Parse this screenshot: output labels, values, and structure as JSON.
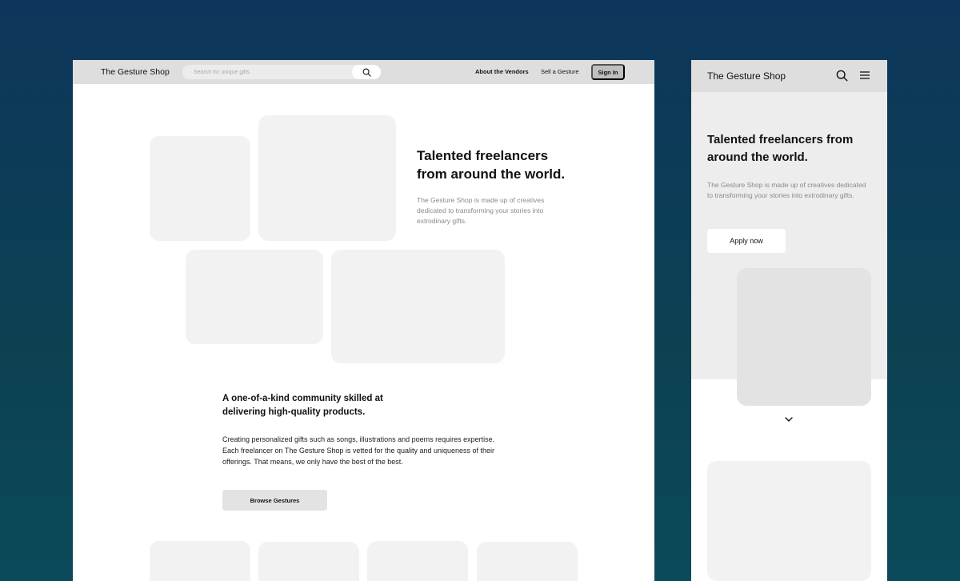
{
  "desktop": {
    "nav": {
      "logo": "The Gesture Shop",
      "search_placeholder": "Search for unique gifts",
      "links": [
        "About the Vendors",
        "Sell a Gesture"
      ],
      "sign_in": "Sign In"
    },
    "hero": {
      "title_line1": "Talented freelancers",
      "title_line2": "from around the world.",
      "body": "The Gesture Shop is made up of creatives dedicated to transforming your stories into extrodinary gifts."
    },
    "community": {
      "title": "A one-of-a-kind community skilled at delivering high-quality products.",
      "body": "Creating personalized gifts such as songs, illustrations and poems requires expertise. Each freelancer on The Gesture Shop is vetted for the quality and uniqueness of their offerings. That means, we only have the best of the best.",
      "button": "Browse Gestures"
    }
  },
  "mobile": {
    "nav": {
      "logo": "The Gesture Shop",
      "icons": [
        "search-icon",
        "menu-icon"
      ]
    },
    "hero": {
      "title": "Talented freelancers from around the world.",
      "body": "The Gesture Shop is made up of creatives dedicated to transforming your stories into extrodinary gifts.",
      "button": "Apply now"
    },
    "scroll_icon": "chevron-down-icon"
  },
  "colors": {
    "background_top": "#0d365c",
    "background_bottom": "#0b4a5a",
    "nav_gray": "#dedede",
    "placeholder": "#f2f2f2",
    "button_gray": "#bfbfbf"
  }
}
